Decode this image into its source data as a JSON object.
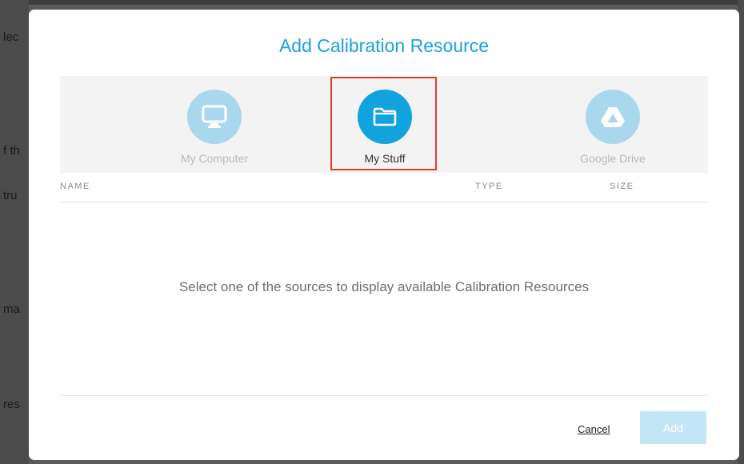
{
  "background": {
    "fragments": [
      "lec",
      "f th",
      "tru",
      "ma",
      "res"
    ]
  },
  "dialog": {
    "title": "Add Calibration Resource",
    "sources": [
      {
        "label": "My Computer",
        "icon": "monitor-icon",
        "selected": false
      },
      {
        "label": "My Stuff",
        "icon": "folder-icon",
        "selected": true
      },
      {
        "label": "Google Drive",
        "icon": "google-drive-icon",
        "selected": false
      }
    ],
    "columns": {
      "name": "NAME",
      "type": "TYPE",
      "size": "SIZE"
    },
    "empty_message": "Select one of the sources to display available Calibration Resources",
    "cancel_label": "Cancel",
    "add_label": "Add",
    "colors": {
      "accent": "#12a3df",
      "accent_light": "#a9d8ee",
      "highlight": "#e23b2c"
    }
  }
}
